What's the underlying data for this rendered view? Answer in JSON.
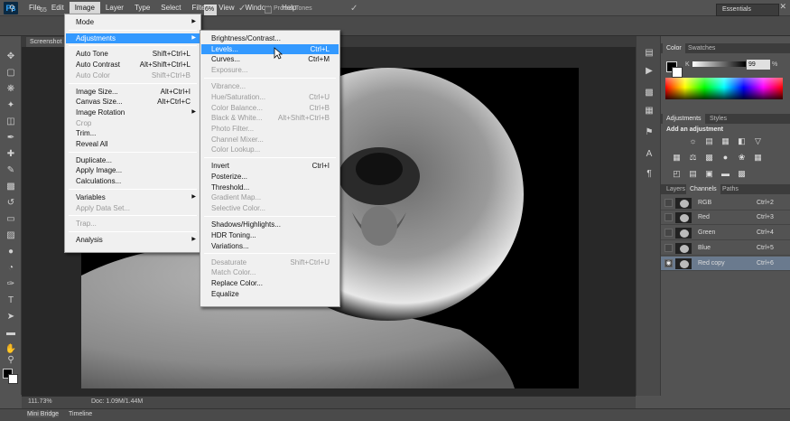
{
  "app": {
    "logo": "Ps"
  },
  "menubar": {
    "items": [
      "File",
      "Edit",
      "Image",
      "Layer",
      "Type",
      "Select",
      "Filter",
      "View",
      "Window",
      "Help"
    ],
    "active": "Image",
    "window_controls": [
      "–",
      "▭",
      "✕"
    ]
  },
  "options": {
    "brush_size": "65",
    "opacity_fragment": "6%",
    "protect_tones": "Protect Tones",
    "workspace": "Essentials"
  },
  "document": {
    "tab_label": "Screenshot",
    "zoom": "111.73%",
    "doc_size": "Doc: 1.09M/1.44M"
  },
  "bottom_tabs": [
    "Mini Bridge",
    "Timeline"
  ],
  "image_menu": {
    "items": [
      {
        "label": "Mode",
        "shortcut": "",
        "submenu": true,
        "disabled": false
      },
      {
        "sep": true
      },
      {
        "label": "Adjustments",
        "shortcut": "",
        "submenu": true,
        "disabled": false,
        "highlight": true
      },
      {
        "sep": true
      },
      {
        "label": "Auto Tone",
        "shortcut": "Shift+Ctrl+L",
        "disabled": false
      },
      {
        "label": "Auto Contrast",
        "shortcut": "Alt+Shift+Ctrl+L",
        "disabled": false
      },
      {
        "label": "Auto Color",
        "shortcut": "Shift+Ctrl+B",
        "disabled": true
      },
      {
        "sep": true
      },
      {
        "label": "Image Size...",
        "shortcut": "Alt+Ctrl+I",
        "disabled": false
      },
      {
        "label": "Canvas Size...",
        "shortcut": "Alt+Ctrl+C",
        "disabled": false
      },
      {
        "label": "Image Rotation",
        "shortcut": "",
        "submenu": true,
        "disabled": false
      },
      {
        "label": "Crop",
        "shortcut": "",
        "disabled": true
      },
      {
        "label": "Trim...",
        "shortcut": "",
        "disabled": false
      },
      {
        "label": "Reveal All",
        "shortcut": "",
        "disabled": false
      },
      {
        "sep": true
      },
      {
        "label": "Duplicate...",
        "shortcut": "",
        "disabled": false
      },
      {
        "label": "Apply Image...",
        "shortcut": "",
        "disabled": false
      },
      {
        "label": "Calculations...",
        "shortcut": "",
        "disabled": false
      },
      {
        "sep": true
      },
      {
        "label": "Variables",
        "shortcut": "",
        "submenu": true,
        "disabled": false
      },
      {
        "label": "Apply Data Set...",
        "shortcut": "",
        "disabled": true
      },
      {
        "sep": true
      },
      {
        "label": "Trap...",
        "shortcut": "",
        "disabled": true
      },
      {
        "sep": true
      },
      {
        "label": "Analysis",
        "shortcut": "",
        "submenu": true,
        "disabled": false
      }
    ]
  },
  "adjustments_menu": {
    "items": [
      {
        "label": "Brightness/Contrast...",
        "shortcut": "",
        "disabled": false
      },
      {
        "label": "Levels...",
        "shortcut": "Ctrl+L",
        "disabled": false,
        "highlight": true
      },
      {
        "label": "Curves...",
        "shortcut": "Ctrl+M",
        "disabled": false
      },
      {
        "label": "Exposure...",
        "shortcut": "",
        "disabled": true
      },
      {
        "sep": true
      },
      {
        "label": "Vibrance...",
        "shortcut": "",
        "disabled": true
      },
      {
        "label": "Hue/Saturation...",
        "shortcut": "Ctrl+U",
        "disabled": true
      },
      {
        "label": "Color Balance...",
        "shortcut": "Ctrl+B",
        "disabled": true
      },
      {
        "label": "Black & White...",
        "shortcut": "Alt+Shift+Ctrl+B",
        "disabled": true
      },
      {
        "label": "Photo Filter...",
        "shortcut": "",
        "disabled": true
      },
      {
        "label": "Channel Mixer...",
        "shortcut": "",
        "disabled": true
      },
      {
        "label": "Color Lookup...",
        "shortcut": "",
        "disabled": true
      },
      {
        "sep": true
      },
      {
        "label": "Invert",
        "shortcut": "Ctrl+I",
        "disabled": false
      },
      {
        "label": "Posterize...",
        "shortcut": "",
        "disabled": false
      },
      {
        "label": "Threshold...",
        "shortcut": "",
        "disabled": false
      },
      {
        "label": "Gradient Map...",
        "shortcut": "",
        "disabled": true
      },
      {
        "label": "Selective Color...",
        "shortcut": "",
        "disabled": true
      },
      {
        "sep": true
      },
      {
        "label": "Shadows/Highlights...",
        "shortcut": "",
        "disabled": false
      },
      {
        "label": "HDR Toning...",
        "shortcut": "",
        "disabled": false
      },
      {
        "label": "Variations...",
        "shortcut": "",
        "disabled": false
      },
      {
        "sep": true
      },
      {
        "label": "Desaturate",
        "shortcut": "Shift+Ctrl+U",
        "disabled": true
      },
      {
        "label": "Match Color...",
        "shortcut": "",
        "disabled": true
      },
      {
        "label": "Replace Color...",
        "shortcut": "",
        "disabled": false
      },
      {
        "label": "Equalize",
        "shortcut": "",
        "disabled": false
      }
    ]
  },
  "color_panel": {
    "tabs": [
      "Color",
      "Swatches"
    ],
    "channel_label": "K",
    "value": "99",
    "unit": "%"
  },
  "adjustments_panel": {
    "tabs": [
      "Adjustments",
      "Styles"
    ],
    "title": "Add an adjustment"
  },
  "channels_panel": {
    "tabs": [
      "Layers",
      "Channels",
      "Paths"
    ],
    "rows": [
      {
        "name": "RGB",
        "shortcut": "Ctrl+2",
        "selected": false,
        "visible": false
      },
      {
        "name": "Red",
        "shortcut": "Ctrl+3",
        "selected": false,
        "visible": false
      },
      {
        "name": "Green",
        "shortcut": "Ctrl+4",
        "selected": false,
        "visible": false
      },
      {
        "name": "Blue",
        "shortcut": "Ctrl+5",
        "selected": false,
        "visible": false
      },
      {
        "name": "Red copy",
        "shortcut": "Ctrl+6",
        "selected": true,
        "visible": true
      }
    ]
  }
}
